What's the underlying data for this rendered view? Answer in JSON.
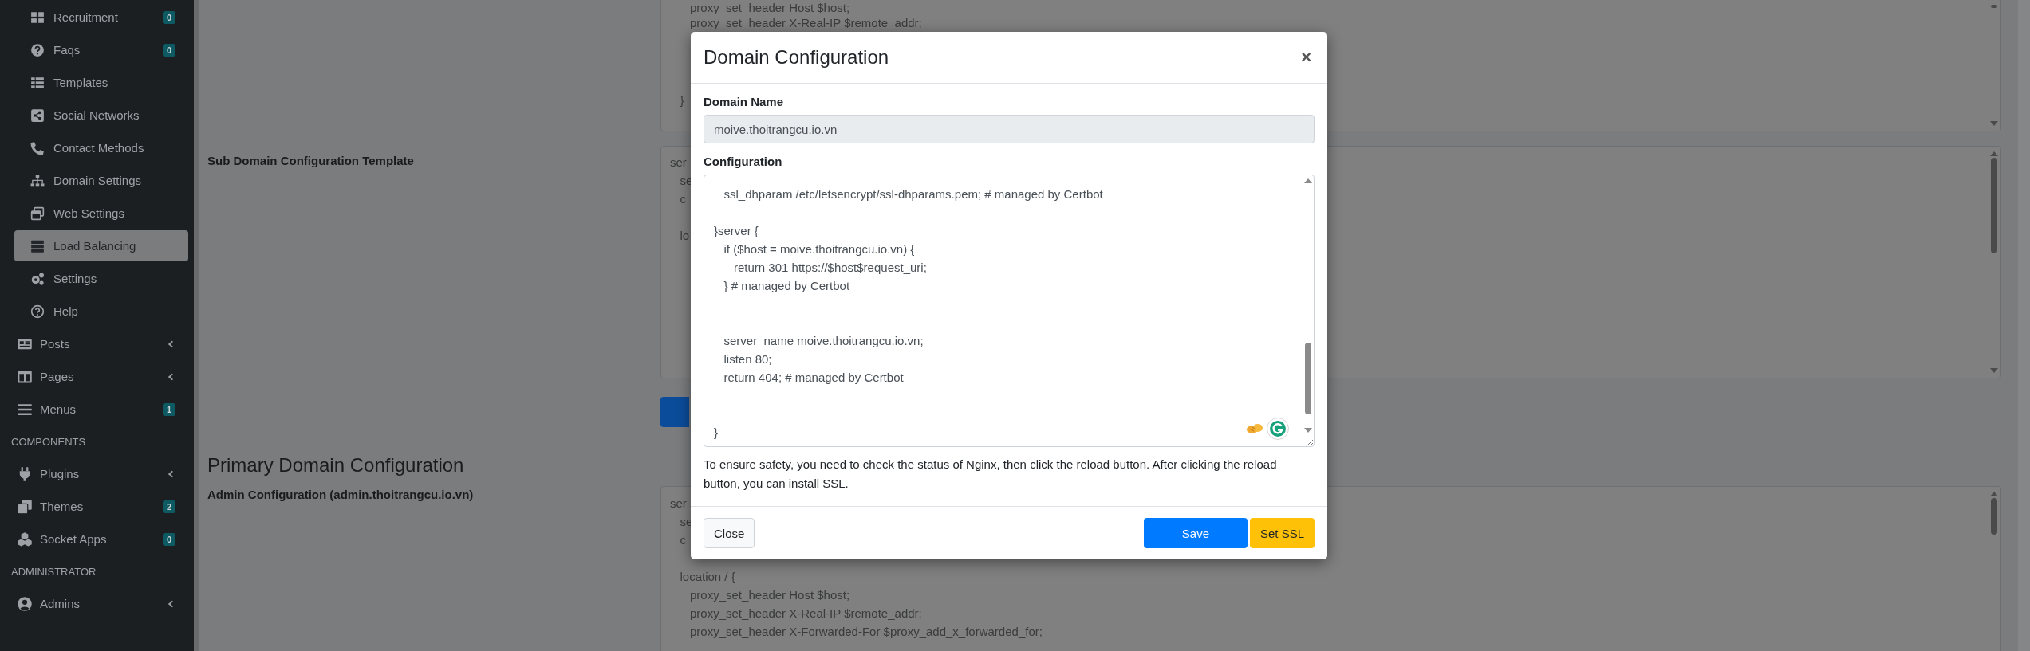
{
  "sidebar": {
    "submenu_items": [
      {
        "label": "Recruitment",
        "badge": "0",
        "selected": false
      },
      {
        "label": "Faqs",
        "badge": "0",
        "selected": false
      },
      {
        "label": "Templates",
        "selected": false
      },
      {
        "label": "Social Networks",
        "selected": false
      },
      {
        "label": "Contact Methods",
        "selected": false
      },
      {
        "label": "Domain Settings",
        "selected": false
      },
      {
        "label": "Web Settings",
        "selected": false
      },
      {
        "label": "Load Balancing",
        "selected": true
      },
      {
        "label": "Settings",
        "selected": false
      },
      {
        "label": "Help",
        "selected": false
      }
    ],
    "items": [
      {
        "kind": "link",
        "label": "Posts",
        "expanded": false,
        "selected": false
      },
      {
        "kind": "link",
        "label": "Pages",
        "expanded": false,
        "selected": false
      },
      {
        "kind": "link",
        "label": "Menus",
        "badge": "1",
        "selected": false
      },
      {
        "kind": "header",
        "label": "COMPONENTS"
      },
      {
        "kind": "link",
        "label": "Plugins",
        "expanded": false,
        "selected": false
      },
      {
        "kind": "link",
        "label": "Themes",
        "badge": "2",
        "selected": false
      },
      {
        "kind": "link",
        "label": "Socket Apps",
        "badge": "0",
        "selected": false
      },
      {
        "kind": "header",
        "label": "ADMINISTRATOR"
      },
      {
        "kind": "link",
        "label": "Admins",
        "expanded": false,
        "selected": false
      }
    ]
  },
  "page": {
    "top_config": {
      "visible_text": [
        [
          "      proxy_set_header Host $host;",
          "      proxy_set_header X-Real-IP $remote_addr;"
        ],
        [
          "   }"
        ]
      ]
    },
    "sub_domain_template": {
      "label": "Sub Domain Configuration Template",
      "visible_text": [
        [
          "ser",
          "   se",
          "   c"
        ],
        [
          "   lo"
        ]
      ]
    },
    "section_title": "Primary Domain Configuration",
    "admin_config": {
      "label": "Admin Configuration (admin.thoitrangcu.io.vn)",
      "visible_text": [
        [
          "ser",
          "   se",
          "   c"
        ],
        [
          "   location / {",
          "      proxy_set_header Host $host;",
          "      proxy_set_header X-Real-IP $remote_addr;",
          "      proxy_set_header X-Forwarded-For $proxy_add_x_forwarded_for;"
        ]
      ]
    }
  },
  "modal": {
    "title": "Domain Configuration",
    "close": "×",
    "domain_name": {
      "label": "Domain Name",
      "value": "moive.thoitrangcu.io.vn",
      "disabled": true
    },
    "configuration": {
      "label": "Configuration",
      "value": "   ssl_dhparam /etc/letsencrypt/ssl-dhparams.pem; # managed by Certbot\n\n}server {\n   if ($host = moive.thoitrangcu.io.vn) {\n      return 301 https://$host$request_uri;\n   } # managed by Certbot\n\n\n   server_name moive.thoitrangcu.io.vn;\n   listen 80;\n   return 404; # managed by Certbot\n\n\n}"
    },
    "help_text": "To ensure safety, you need to check the status of Nginx, then click the reload button. After clicking the reload button, you can install SSL.",
    "buttons": [
      {
        "label": "Close",
        "kind": "secondary"
      },
      {
        "label": "Save",
        "kind": "primary"
      },
      {
        "label": "Set SSL",
        "kind": "warning"
      }
    ]
  }
}
